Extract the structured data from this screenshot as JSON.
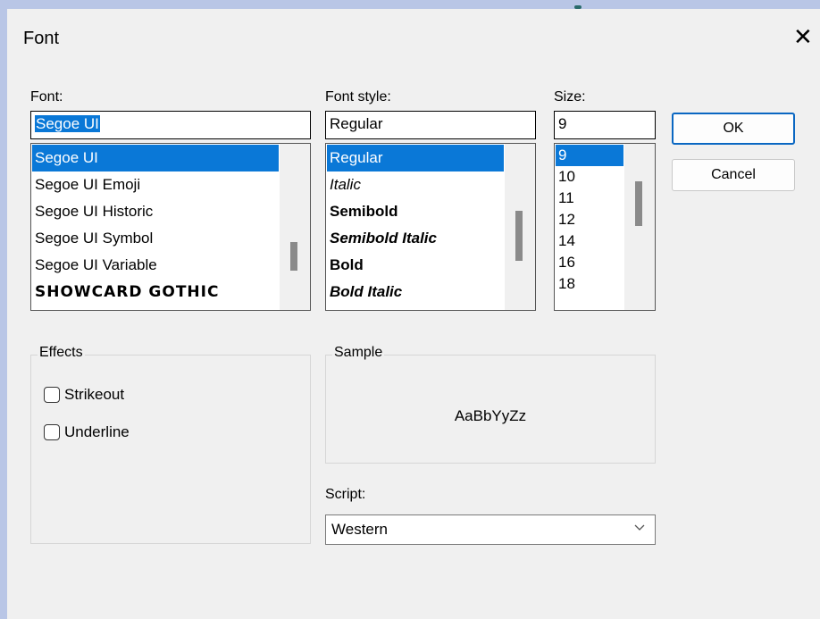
{
  "dialog": {
    "title": "Font",
    "close_icon": "close-icon"
  },
  "font": {
    "label": "Font:",
    "value": "Segoe UI",
    "items": [
      "Segoe UI",
      "Segoe UI Emoji",
      "Segoe UI Historic",
      "Segoe UI Symbol",
      "Segoe UI Variable",
      "SHOWCARD GOTHIC"
    ]
  },
  "style": {
    "label": "Font style:",
    "value": "Regular",
    "items": [
      "Regular",
      "Italic",
      "Semibold",
      "Semibold Italic",
      "Bold",
      "Bold Italic"
    ]
  },
  "size": {
    "label": "Size:",
    "value": "9",
    "items": [
      "9",
      "10",
      "11",
      "12",
      "14",
      "16",
      "18"
    ]
  },
  "buttons": {
    "ok": "OK",
    "cancel": "Cancel"
  },
  "effects": {
    "title": "Effects",
    "strikeout": "Strikeout",
    "underline": "Underline"
  },
  "sample": {
    "title": "Sample",
    "text": "AaBbYyZz"
  },
  "script": {
    "label": "Script:",
    "value": "Western",
    "dropdown_icon": "chevron-down-icon"
  },
  "colors": {
    "selection": "#0a78d7",
    "default_button_border": "#0a67c2"
  }
}
